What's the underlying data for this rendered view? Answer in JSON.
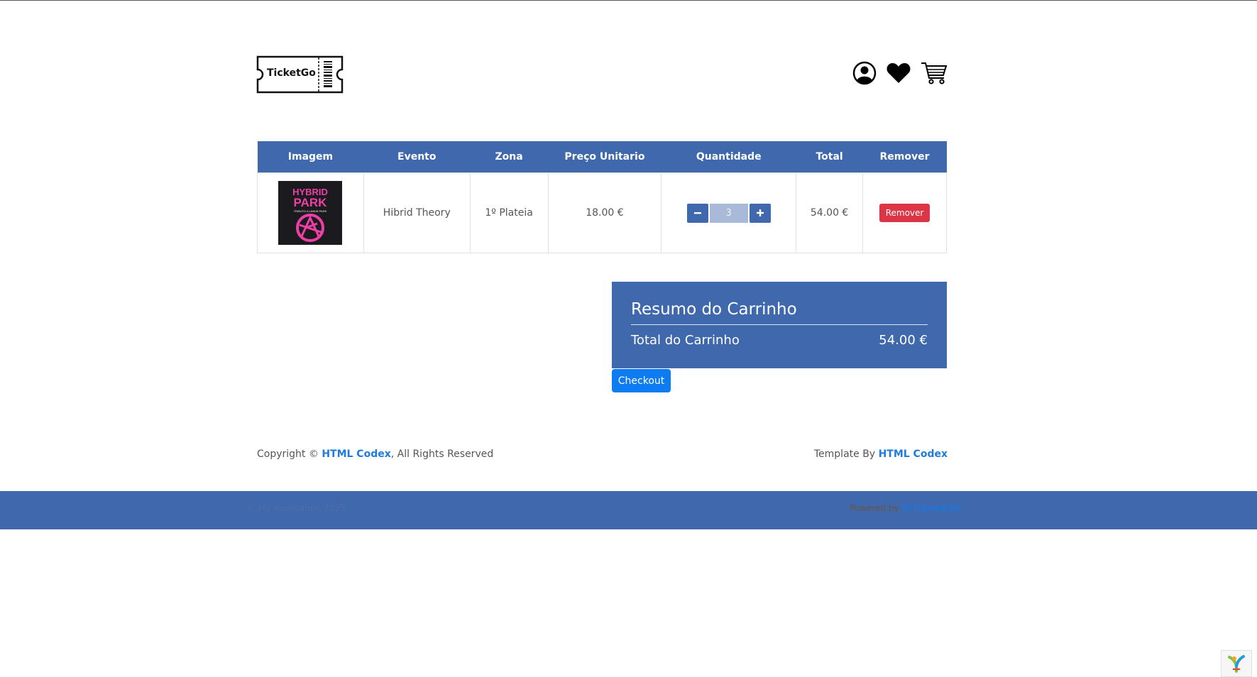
{
  "brand": {
    "name": "TicketGo"
  },
  "table": {
    "headers": [
      "Imagem",
      "Evento",
      "Zona",
      "Preço Unitario",
      "Quantidade",
      "Total",
      "Remover"
    ],
    "rows": [
      {
        "image_text_1": "HYBRID",
        "image_text_2": "PARK",
        "image_text_3": "TRIBUTO A LINKIN PARK",
        "evento": "Hibrid Theory",
        "zona": "1º Plateia",
        "preco": "18.00 €",
        "quantidade": "3",
        "total": "54.00 €",
        "remover_label": "Remover"
      }
    ]
  },
  "summary": {
    "title": "Resumo do Carrinho",
    "total_label": "Total do Carrinho",
    "total_value": "54.00 €"
  },
  "checkout_label": "Checkout",
  "footer": {
    "copyright_prefix": "Copyright ©",
    "copyright_link": "HTML Codex",
    "copyright_suffix": ", All Rights Reserved",
    "template_prefix": "Template By",
    "template_link": "HTML Codex",
    "bar_left": "© My Application 2025",
    "bar_right_prefix": "Powered by",
    "bar_right_link": "Yii Framework"
  },
  "colors": {
    "primary": "#3f68ad",
    "danger": "#dc3545",
    "checkout": "#0d7bf2"
  },
  "icons": [
    "user-circle-icon",
    "heart-icon",
    "cart-icon",
    "minus-icon",
    "plus-icon",
    "yii-logo-icon"
  ]
}
